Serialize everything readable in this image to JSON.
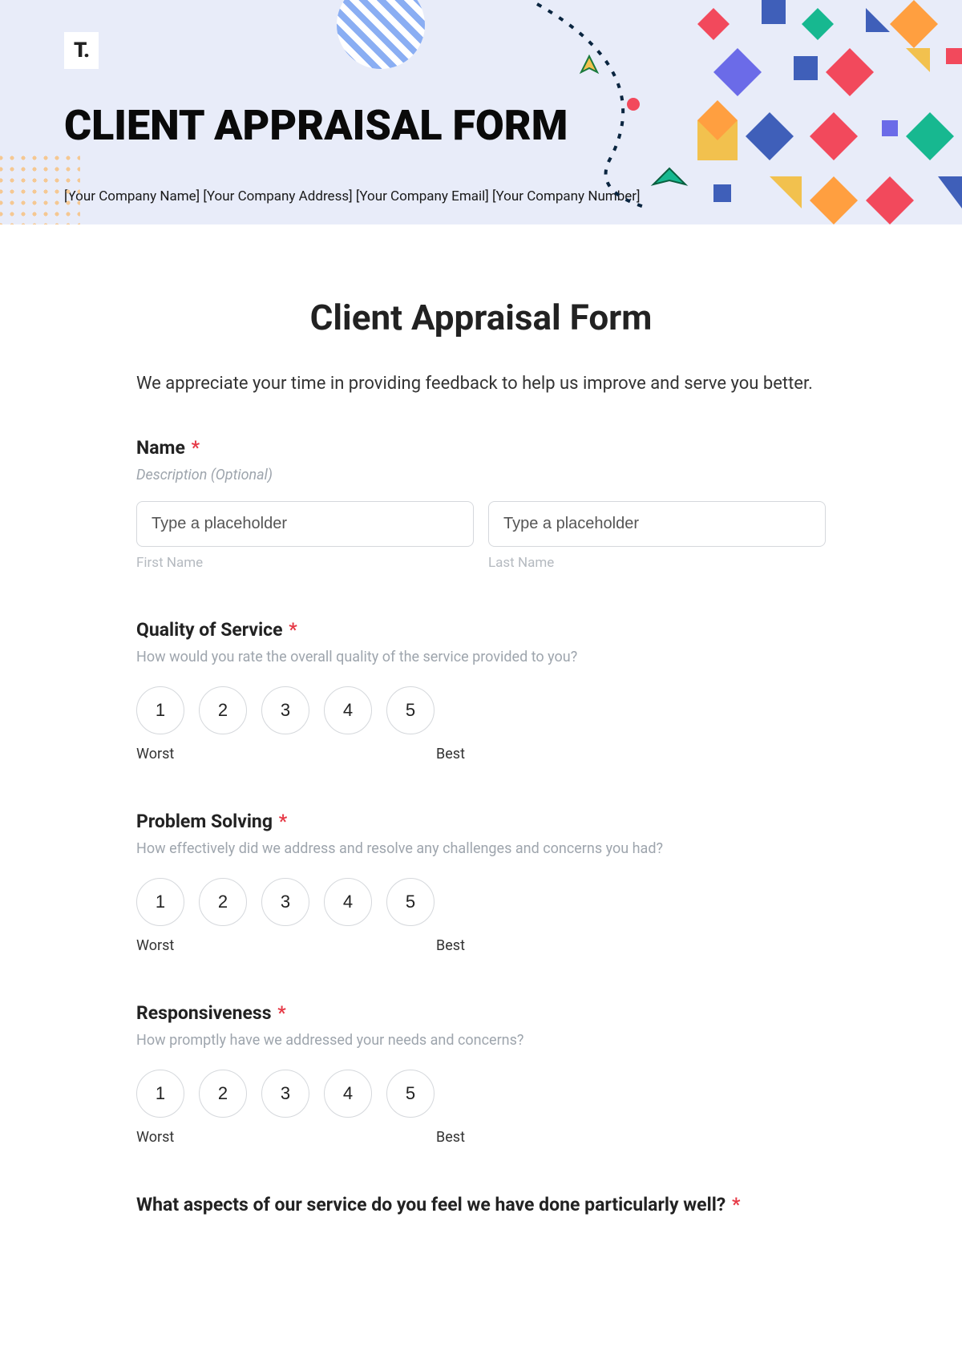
{
  "hero": {
    "logo": "T.",
    "title": "CLIENT APPRAISAL FORM",
    "subtitle": "[Your Company Name] [Your Company Address] [Your Company Email] [Your Company Number]"
  },
  "form": {
    "title": "Client Appraisal Form",
    "intro": "We appreciate your time in providing feedback to help us improve and serve you better.",
    "name": {
      "label": "Name",
      "description": "Description (Optional)",
      "first_placeholder": "Type a placeholder",
      "first_sub": "First Name",
      "last_placeholder": "Type a placeholder",
      "last_sub": "Last Name"
    },
    "quality": {
      "label": "Quality of Service",
      "help": "How would you rate the overall quality of the service provided to you?",
      "options": [
        "1",
        "2",
        "3",
        "4",
        "5"
      ],
      "low": "Worst",
      "high": "Best"
    },
    "problem": {
      "label": "Problem Solving",
      "help": "How effectively did we address and resolve any challenges and concerns you had?",
      "options": [
        "1",
        "2",
        "3",
        "4",
        "5"
      ],
      "low": "Worst",
      "high": "Best"
    },
    "responsiveness": {
      "label": "Responsiveness",
      "help": "How promptly have we addressed your needs and concerns?",
      "options": [
        "1",
        "2",
        "3",
        "4",
        "5"
      ],
      "low": "Worst",
      "high": "Best"
    },
    "aspects": {
      "label": "What aspects of our service do you feel we have done particularly well?"
    },
    "required_marker": "*"
  }
}
